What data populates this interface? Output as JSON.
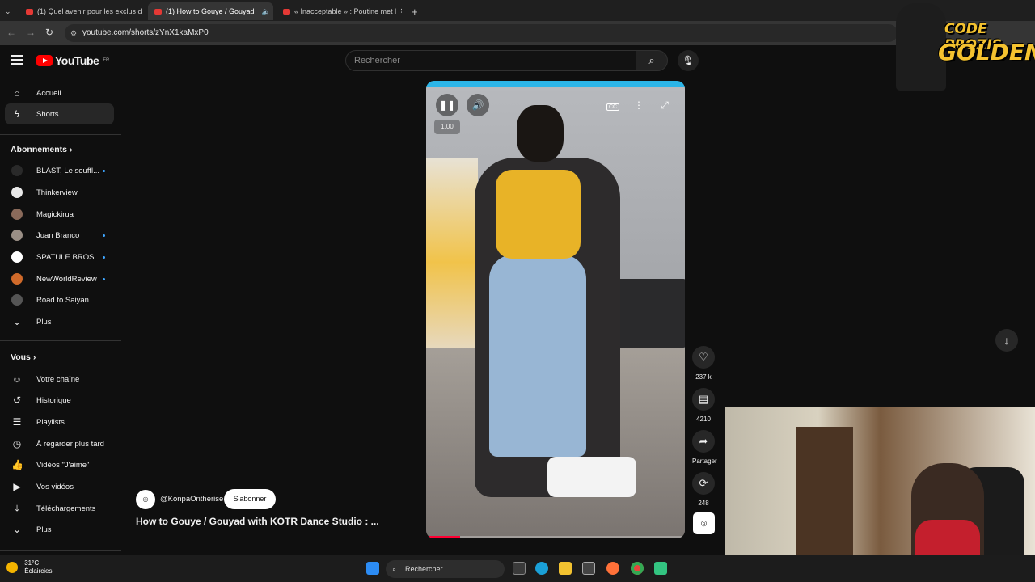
{
  "browser": {
    "tabs": [
      {
        "label": "(1) Quel avenir pour les exclus d",
        "active": false
      },
      {
        "label": "(1) How to Gouye / Gouyad",
        "active": true
      },
      {
        "label": "« Inacceptable » : Poutine met l",
        "active": false
      }
    ],
    "new_tab": "+",
    "url": "youtube.com/shorts/zYnX1kaMxP0"
  },
  "header": {
    "logo_text": "YouTube",
    "region": "FR",
    "search_placeholder": "Rechercher"
  },
  "sidebar": {
    "main": [
      {
        "label": "Accueil",
        "icon": "home-icon"
      },
      {
        "label": "Shorts",
        "icon": "shorts-icon",
        "active": true
      }
    ],
    "subscriptions_title": "Abonnements",
    "subscriptions": [
      {
        "label": "BLAST, Le souffl...",
        "new": true,
        "color": "#2a2a2a"
      },
      {
        "label": "Thinkerview",
        "new": false,
        "color": "#e9e9e9"
      },
      {
        "label": "Magickirua",
        "new": false,
        "color": "#8a6a5a"
      },
      {
        "label": "Juan Branco",
        "new": true,
        "color": "#9a8f86"
      },
      {
        "label": "SPATULE BROS",
        "new": true,
        "color": "#ffffff"
      },
      {
        "label": "NewWorldReview",
        "new": true,
        "color": "#d06a2a"
      },
      {
        "label": "Road to Saiyan",
        "new": false,
        "color": "#555"
      }
    ],
    "subs_more": "Plus",
    "you_title": "Vous",
    "you": [
      {
        "label": "Votre chaîne",
        "icon": "user-icon"
      },
      {
        "label": "Historique",
        "icon": "history-icon"
      },
      {
        "label": "Playlists",
        "icon": "playlist-icon"
      },
      {
        "label": "À regarder plus tard",
        "icon": "clock-icon"
      },
      {
        "label": "Vidéos \"J'aime\"",
        "icon": "thumb-up-icon"
      },
      {
        "label": "Vos vidéos",
        "icon": "video-icon"
      },
      {
        "label": "Téléchargements",
        "icon": "download-icon"
      }
    ],
    "you_more": "Plus"
  },
  "player": {
    "speed": "1.00",
    "progress": 0.13
  },
  "actions": {
    "likes": "237 k",
    "comments": "4210",
    "share": "Partager",
    "remix": "248"
  },
  "video": {
    "channel": "@KonpaOntherise",
    "subscribe": "S'abonner",
    "title": "How to Gouye / Gouyad with KOTR Dance Studio : ..."
  },
  "overlay": {
    "line1": "CODE PROZIS",
    "line2": "GOLDENG"
  },
  "taskbar": {
    "temperature": "31°C",
    "weather": "Éclaircies",
    "search": "Rechercher"
  }
}
